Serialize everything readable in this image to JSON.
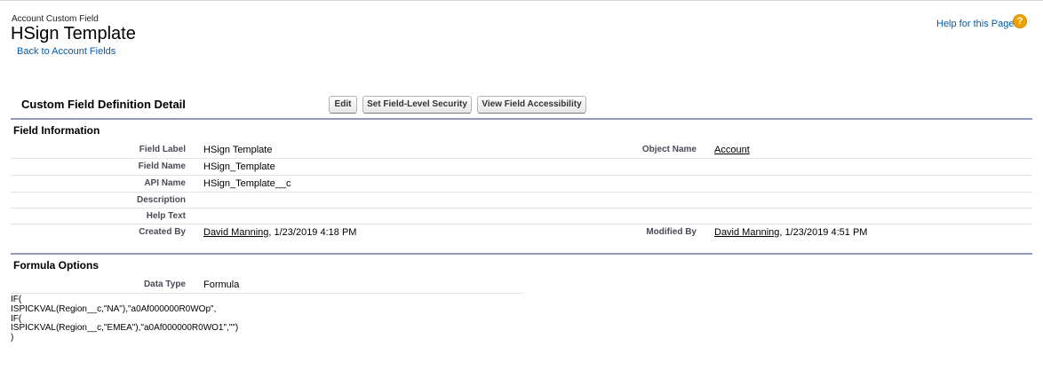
{
  "header": {
    "eyebrow": "Account Custom Field",
    "title": "HSign Template",
    "back_link": "Back to Account Fields",
    "help_link": "Help for this Page",
    "help_icon": "?"
  },
  "detail": {
    "title": "Custom Field Definition Detail",
    "buttons": {
      "edit": "Edit",
      "field_level_security": "Set Field-Level Security",
      "view_accessibility": "View Field Accessibility"
    }
  },
  "field_information": {
    "title": "Field Information",
    "field_label": {
      "label": "Field Label",
      "value": "HSign Template"
    },
    "field_name": {
      "label": "Field Name",
      "value": "HSign_Template"
    },
    "api_name": {
      "label": "API Name",
      "value": "HSign_Template__c"
    },
    "description": {
      "label": "Description",
      "value": ""
    },
    "help_text": {
      "label": "Help Text",
      "value": ""
    },
    "created_by": {
      "label": "Created By",
      "user": "David Manning",
      "date": ", 1/23/2019 4:18 PM"
    },
    "object_name": {
      "label": "Object Name",
      "value": "Account"
    },
    "modified_by": {
      "label": "Modified By",
      "user": "David Manning",
      "date": ", 1/23/2019 4:51 PM"
    }
  },
  "formula_options": {
    "title": "Formula Options",
    "data_type": {
      "label": "Data Type",
      "value": "Formula"
    },
    "formula_lines": [
      "IF(",
      "ISPICKVAL(Region__c,\"NA\"),\"a0Af000000R0WOp\",",
      "IF(",
      "ISPICKVAL(Region__c,\"EMEA\"),\"a0Af000000R0WO1\",\"\")",
      ")"
    ]
  },
  "colors": {
    "link": "#015ba7",
    "section_rule": "#8e9dbe",
    "help_icon": "#f0a000"
  }
}
